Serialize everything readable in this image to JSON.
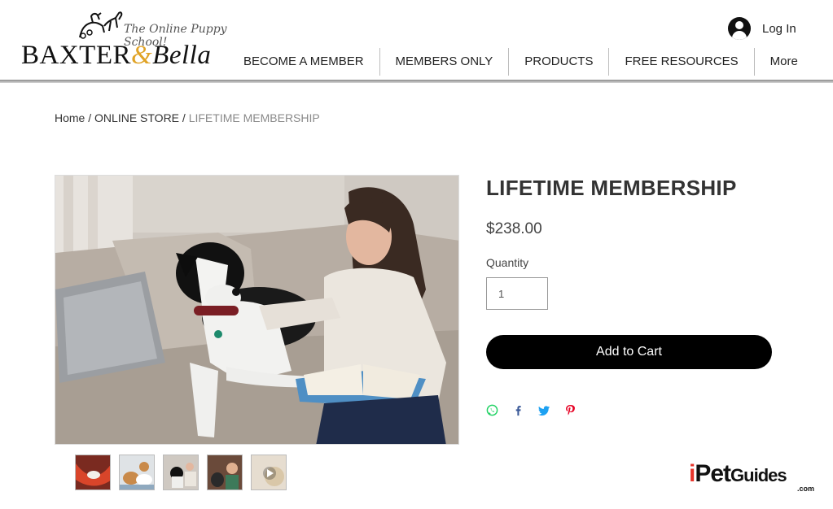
{
  "header": {
    "logo": {
      "tagline": "The Online Puppy School!",
      "brand_left": "BAXTER",
      "brand_amp": "&",
      "brand_right": "Bella"
    },
    "login_label": "Log In",
    "nav": [
      {
        "label": "BECOME A MEMBER"
      },
      {
        "label": "MEMBERS ONLY"
      },
      {
        "label": "PRODUCTS"
      },
      {
        "label": "FREE RESOURCES"
      },
      {
        "label": "More"
      }
    ]
  },
  "breadcrumb": {
    "home": "Home",
    "sep": " / ",
    "store": "ONLINE STORE",
    "current": "LIFETIME MEMBERSHIP"
  },
  "product": {
    "title": "LIFETIME MEMBERSHIP",
    "price": "$238.00",
    "quantity_label": "Quantity",
    "quantity_value": "1",
    "add_to_cart_label": "Add to Cart",
    "main_image": "girl-reading-book-with-dog-on-sofa",
    "thumbnails": [
      "dog-in-red-hammock",
      "dogs-on-blanket",
      "girl-with-dog-on-sofa",
      "boy-with-dogs",
      "puppy-video"
    ],
    "share_icons": [
      "whatsapp-icon",
      "facebook-icon",
      "twitter-icon",
      "pinterest-icon"
    ]
  },
  "watermark": {
    "part_i": "i",
    "part_pet": "Pet",
    "part_guides": "Guides",
    "suffix": ".com"
  },
  "colors": {
    "accent_gold": "#e0a326",
    "button_black": "#000000",
    "whatsapp": "#25d366",
    "facebook": "#3b5998",
    "twitter": "#1da1f2",
    "pinterest": "#e60023",
    "watermark_red": "#e8352c"
  }
}
